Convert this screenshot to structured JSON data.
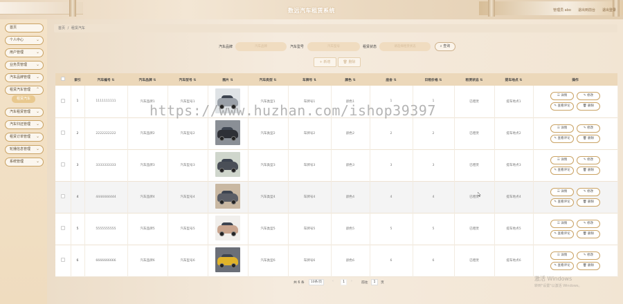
{
  "header": {
    "title": "数远汽车租赁系统",
    "links": [
      "管理员 abo",
      "退出到前台",
      "退出登录"
    ]
  },
  "sidebar": {
    "items": [
      {
        "label": "首页",
        "has_chevron": false
      },
      {
        "label": "个人中心",
        "has_chevron": true
      },
      {
        "label": "用户管理",
        "has_chevron": true
      },
      {
        "label": "业务员管理",
        "has_chevron": true
      },
      {
        "label": "汽车品牌管理",
        "has_chevron": true
      },
      {
        "label": "租赁汽车管理",
        "has_chevron": true
      },
      {
        "label": "汽车租赁管理",
        "has_chevron": true
      },
      {
        "label": "汽车归还管理",
        "has_chevron": true
      },
      {
        "label": "租赁订单管理",
        "has_chevron": true
      },
      {
        "label": "轮播信息管理",
        "has_chevron": true
      },
      {
        "label": "系统管理",
        "has_chevron": true
      }
    ],
    "active_sub": "租赁汽车"
  },
  "breadcrumb": {
    "home": "首页",
    "sep": "/",
    "current": "租赁汽车"
  },
  "search": {
    "brand_label": "汽车品牌",
    "brand_placeholder": "汽车品牌",
    "model_label": "汽车型号",
    "model_placeholder": "汽车型号",
    "status_label": "租赁状态",
    "status_placeholder": "请选择租赁状态",
    "query_button": "查询"
  },
  "actions": {
    "add": "+ 新增",
    "delete": "删除"
  },
  "table": {
    "headers": [
      "",
      "索引",
      "汽车编号",
      "汽车品牌",
      "汽车型号",
      "图片",
      "汽车类型",
      "车牌号",
      "颜色",
      "座舍",
      "日租价格",
      "租赁状态",
      "提车地点",
      "操作"
    ],
    "rows": [
      {
        "idx": "1",
        "code": "1111111111",
        "brand": "汽车品牌1",
        "model": "汽车型号1",
        "type": "汽车类型1",
        "plate": "车牌号1",
        "color": "颜色1",
        "seats": "1",
        "price": "1",
        "status": "已租赁",
        "place": "提车地点1",
        "car_color": "#9aa0a8"
      },
      {
        "idx": "2",
        "code": "2222222222",
        "brand": "汽车品牌2",
        "model": "汽车型号2",
        "type": "汽车类型2",
        "plate": "车牌号2",
        "color": "颜色2",
        "seats": "2",
        "price": "2",
        "status": "已租赁",
        "place": "提车地点2",
        "car_color": "#2e3036"
      },
      {
        "idx": "3",
        "code": "3333333333",
        "brand": "汽车品牌3",
        "model": "汽车型号3",
        "type": "汽车类型3",
        "plate": "车牌号3",
        "color": "颜色3",
        "seats": "3",
        "price": "3",
        "status": "已租赁",
        "place": "提车地点3",
        "car_color": "#4a4f57"
      },
      {
        "idx": "4",
        "code": "4444444444",
        "brand": "汽车品牌4",
        "model": "汽车型号4",
        "type": "汽车类型4",
        "plate": "车牌号4",
        "color": "颜色4",
        "seats": "4",
        "price": "4",
        "status": "已租赁",
        "place": "提车地点4",
        "car_color": "#5b5e66"
      },
      {
        "idx": "5",
        "code": "5555555555",
        "brand": "汽车品牌5",
        "model": "汽车型号5",
        "type": "汽车类型5",
        "plate": "车牌号5",
        "color": "颜色5",
        "seats": "5",
        "price": "5",
        "status": "已租赁",
        "place": "提车地点5",
        "car_color": "#c9a58f"
      },
      {
        "idx": "6",
        "code": "6666666666",
        "brand": "汽车品牌6",
        "model": "汽车型号6",
        "type": "汽车类型6",
        "plate": "车牌号6",
        "color": "颜色6",
        "seats": "6",
        "price": "6",
        "status": "已租赁",
        "place": "提车地点6",
        "car_color": "#e0b32a"
      }
    ],
    "ops": {
      "detail": "☰ 详情",
      "edit": "✎ 修改",
      "review": "✎ 查看评论",
      "delete": "🗑 删除"
    }
  },
  "pager": {
    "total": "共 6 条",
    "page_size": "10条/页",
    "prev": "‹",
    "page": "1",
    "next": "›",
    "goto_prefix": "前往",
    "goto_value": "1",
    "goto_suffix": "页"
  },
  "watermark": "https://www.huzhan.com/ishop39397",
  "activation": {
    "line1": "激活 Windows",
    "line2": "转到\"设置\"以激活 Windows。"
  }
}
